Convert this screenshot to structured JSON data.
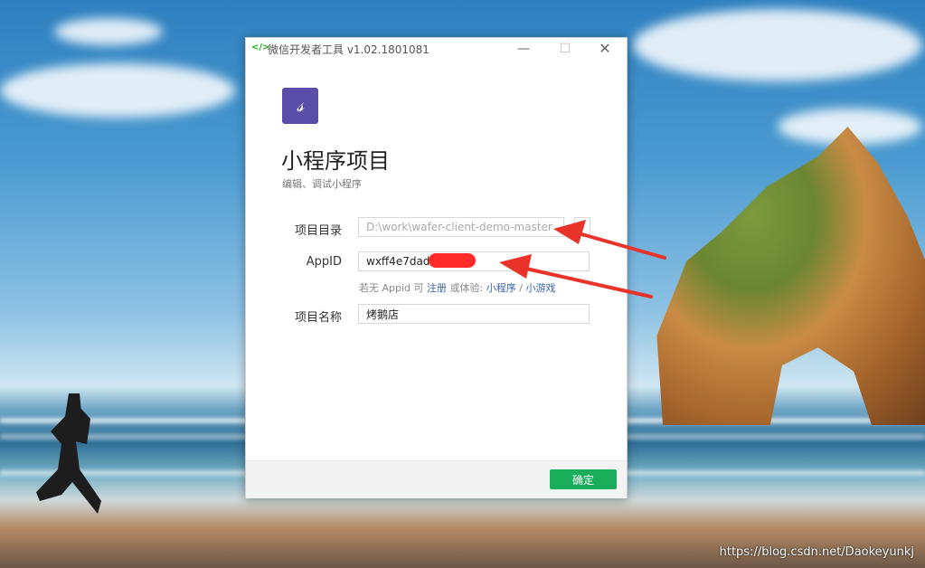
{
  "window": {
    "title": "微信开发者工具 v1.02.1801081",
    "app_icon": "</>",
    "minimize": "—",
    "maximize": "☐",
    "close": "✕"
  },
  "header": {
    "logo_glyph": "𝓈",
    "title": "小程序项目",
    "subtitle": "编辑、调试小程序"
  },
  "form": {
    "dir_label": "项目目录",
    "dir_value": "D:\\work\\wafer-client-demo-master",
    "dir_toggle": "⌄",
    "appid_label": "AppID",
    "appid_value": "wxff4e7dad7",
    "hint_prefix": "若无 Appid 可",
    "hint_register": "注册",
    "hint_middle": "或体验:",
    "hint_mini": "小程序",
    "hint_sep": "/",
    "hint_game": "小游戏",
    "name_label": "项目名称",
    "name_value": "烤鹅店"
  },
  "footer": {
    "ok_label": "确定"
  },
  "desktop": {
    "watermark": "https://blog.csdn.net/Daokeyunkj"
  },
  "colors": {
    "accent": "#1aad5a",
    "logo_bg": "#5b4ea9",
    "link": "#3a63b5",
    "annotation": "#e8322a"
  }
}
